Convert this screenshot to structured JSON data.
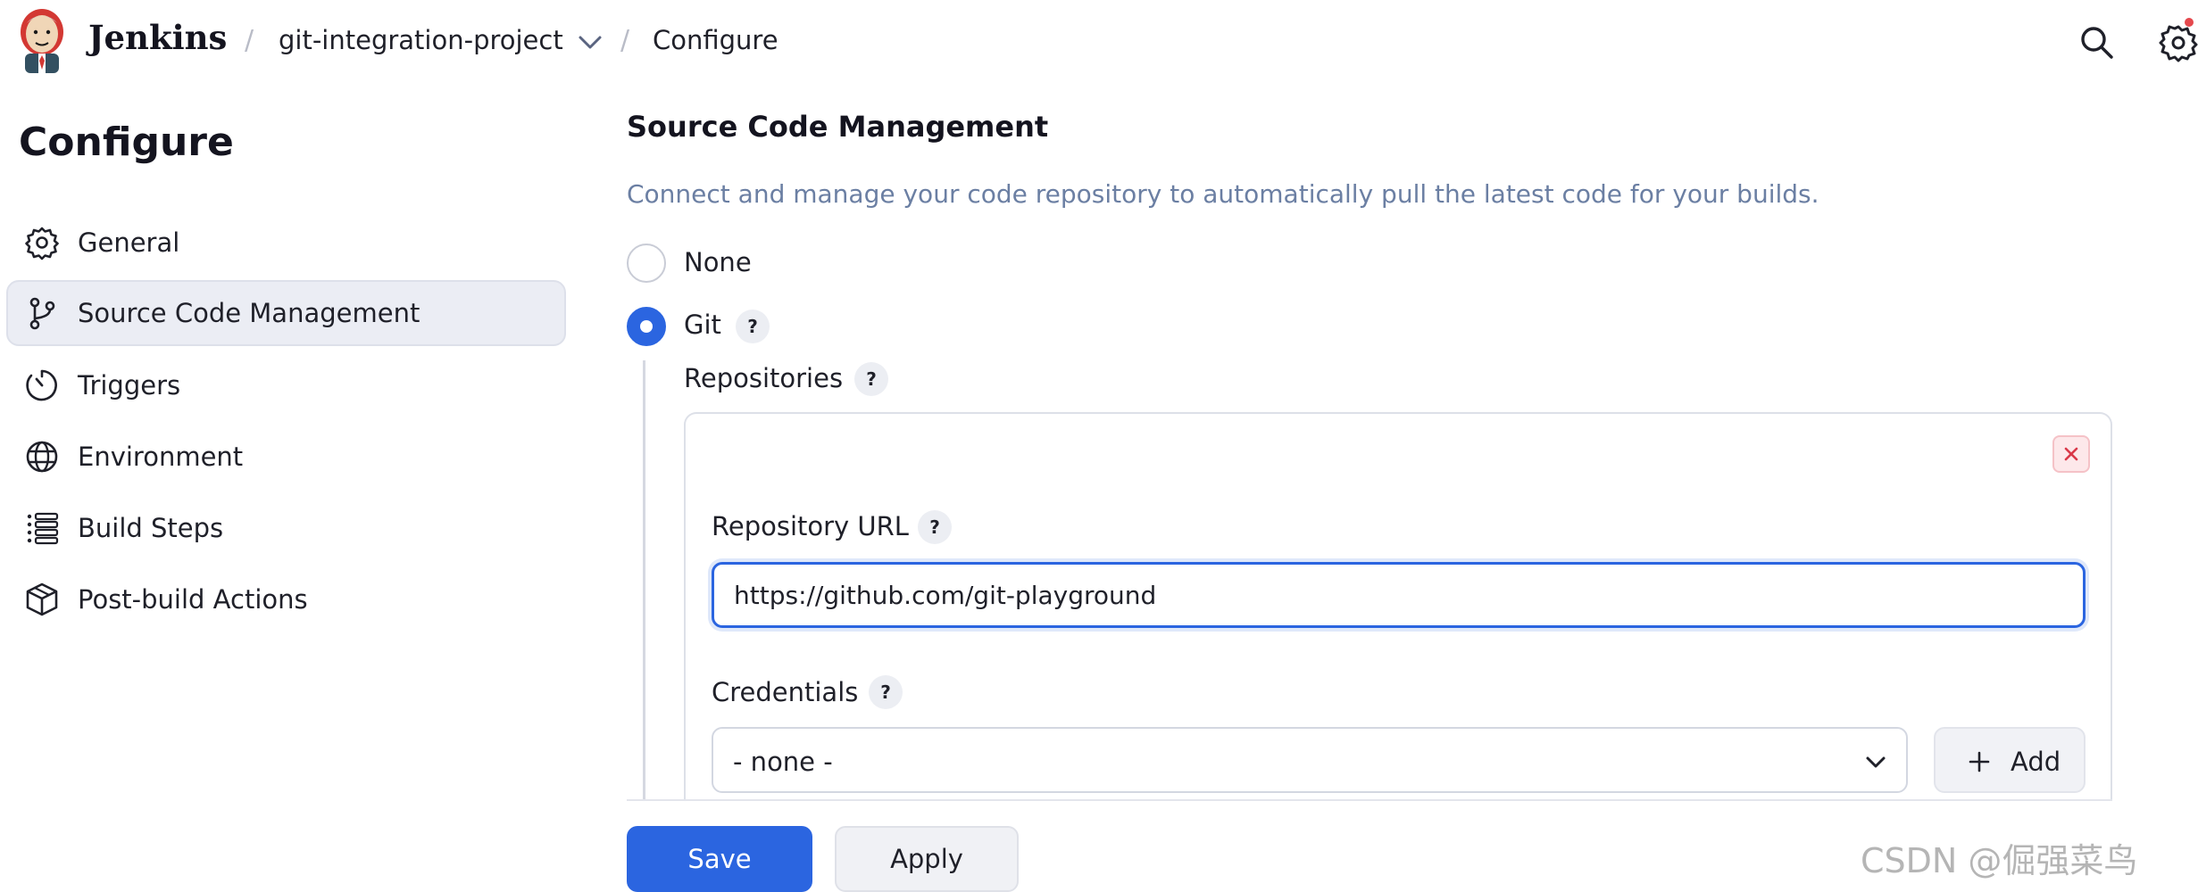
{
  "header": {
    "brand": "Jenkins",
    "breadcrumbs": [
      {
        "label": "git-integration-project"
      },
      {
        "label": "Configure"
      }
    ],
    "separator": "/"
  },
  "sidebar": {
    "title": "Configure",
    "items": [
      {
        "label": "General",
        "icon": "gear-icon",
        "active": false
      },
      {
        "label": "Source Code Management",
        "icon": "branch-icon",
        "active": true
      },
      {
        "label": "Triggers",
        "icon": "timer-icon",
        "active": false
      },
      {
        "label": "Environment",
        "icon": "globe-icon",
        "active": false
      },
      {
        "label": "Build Steps",
        "icon": "list-icon",
        "active": false
      },
      {
        "label": "Post-build Actions",
        "icon": "package-icon",
        "active": false
      }
    ]
  },
  "main": {
    "section_title": "Source Code Management",
    "section_description": "Connect and manage your code repository to automatically pull the latest code for your builds.",
    "scm_options": [
      {
        "label": "None",
        "checked": false
      },
      {
        "label": "Git",
        "checked": true
      }
    ],
    "help_label": "?",
    "repositories": {
      "label": "Repositories",
      "url_label": "Repository URL",
      "url_value": "https://github.com/git-playground",
      "credentials_label": "Credentials",
      "credentials_value": "- none -",
      "add_label": "Add"
    },
    "save_label": "Save",
    "apply_label": "Apply"
  },
  "colors": {
    "accent": "#2b65e0",
    "danger": "#e5484d",
    "description": "#6b7fa3"
  },
  "watermark": "CSDN @倔强菜鸟"
}
